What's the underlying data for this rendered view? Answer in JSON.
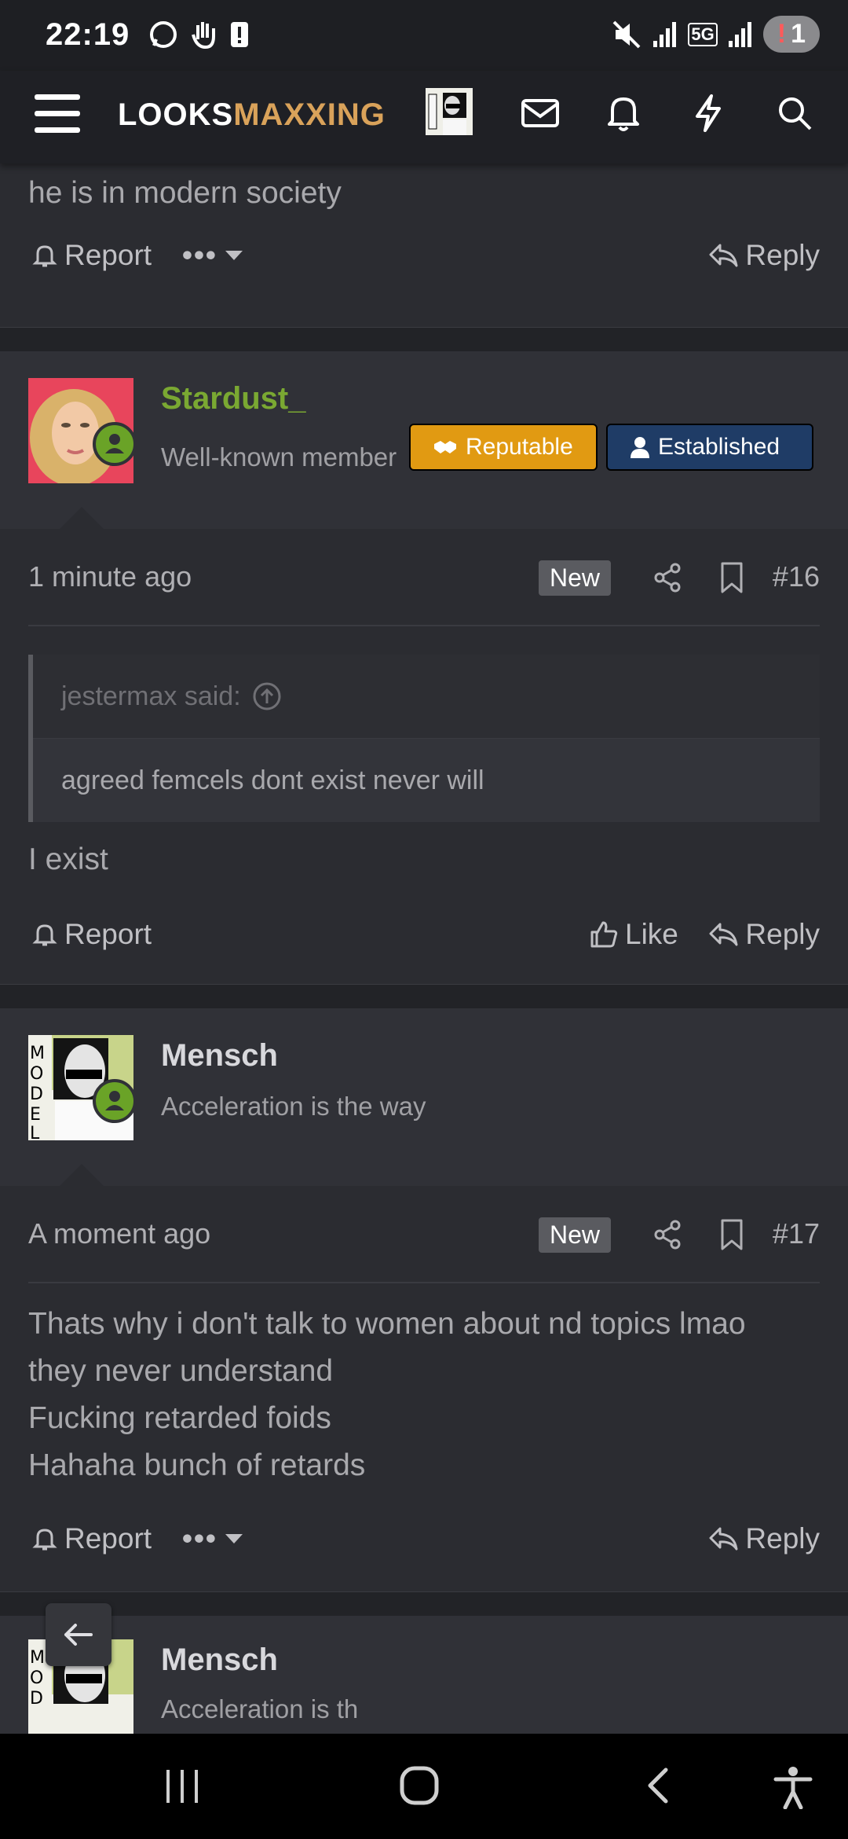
{
  "status_bar": {
    "time": "22:19",
    "notification_count": "1",
    "network_label": "5G"
  },
  "site": {
    "logo_part1": "LOOKS",
    "logo_part2": "MAXXING"
  },
  "post_prev": {
    "tail_text": "he is in modern society",
    "report_label": "Report",
    "more_label": "•••",
    "reply_label": "Reply"
  },
  "post16": {
    "username": "Stardust_",
    "user_title": "Well-known member",
    "badge1": "Reputable",
    "badge2": "Established",
    "date": "1 minute ago",
    "new_label": "New",
    "number": "#16",
    "quote_author": "jestermax said:",
    "quote_text": "agreed femcels dont exist never will",
    "body": "I exist",
    "report_label": "Report",
    "like_label": "Like",
    "reply_label": "Reply"
  },
  "post17": {
    "username": "Mensch",
    "user_title": "Acceleration is the way",
    "date": "A moment ago",
    "new_label": "New",
    "number": "#17",
    "body_lines": [
      "Thats why i don't talk to women about nd topics lmao",
      "they never understand",
      "Fucking retarded foids",
      "Hahaha bunch of retards"
    ],
    "report_label": "Report",
    "more_label": "•••",
    "reply_label": "Reply"
  },
  "post18": {
    "username": "Mensch",
    "user_title_partial": "Acceleration is th"
  },
  "colors": {
    "accent_gold": "#d9a25a",
    "username_green": "#7aa832",
    "badge_reputable": "#e19a12",
    "badge_established": "#1f3c66"
  }
}
